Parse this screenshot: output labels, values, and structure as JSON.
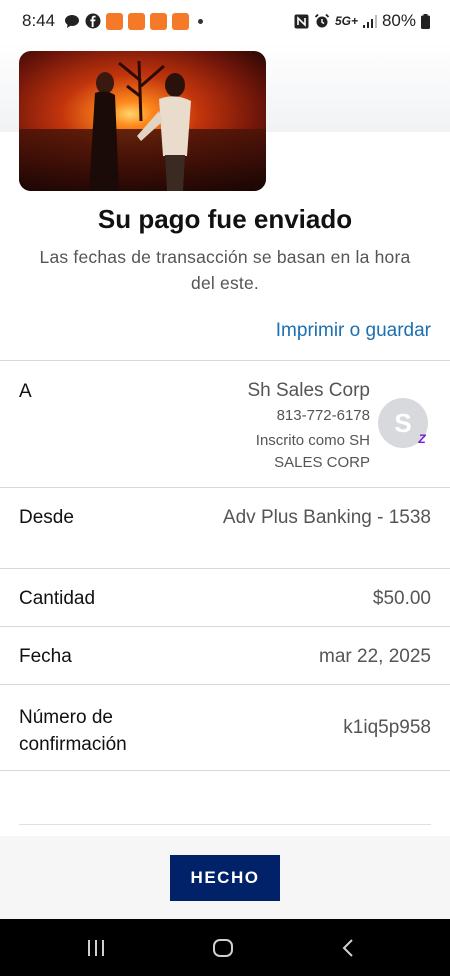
{
  "status_bar": {
    "time": "8:44",
    "network": "5G+",
    "battery": "80%"
  },
  "header": {
    "image_icon": "couple-at-sunset-photo"
  },
  "confirmation": {
    "title": "Su pago fue enviado",
    "subtitle": "Las fechas de transacción se basan en la hora del este.",
    "print_link": "Imprimir o guardar"
  },
  "details": {
    "to": {
      "label": "A",
      "name": "Sh Sales Corp",
      "phone": "813-772-6178",
      "enrolled": "Inscrito como SH SALES CORP",
      "avatar_initial": "S",
      "badge": "Z"
    },
    "from": {
      "label": "Desde",
      "value": "Adv Plus Banking - 1538"
    },
    "amount": {
      "label": "Cantidad",
      "value": "$50.00"
    },
    "date": {
      "label": "Fecha",
      "value": "mar 22, 2025"
    },
    "confirmation_number": {
      "label": "Número de confirmación",
      "value": "k1iq5p958"
    }
  },
  "footer": {
    "done_label": "HECHO"
  },
  "colors": {
    "link": "#1b6fb2",
    "button": "#012169",
    "zelle": "#6d1ed4"
  }
}
